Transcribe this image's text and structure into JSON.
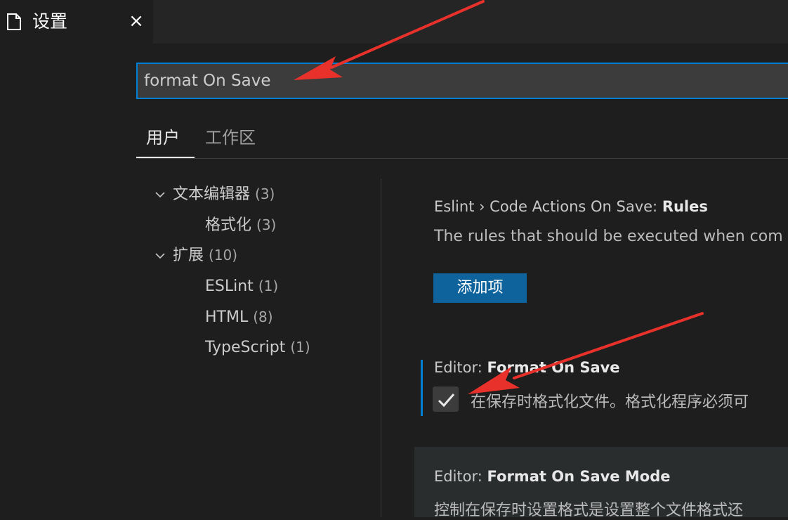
{
  "tab": {
    "title": "设置",
    "close": "×"
  },
  "search": {
    "value": "format On Save"
  },
  "scope_tabs": {
    "user": "用户",
    "workspace": "工作区"
  },
  "toc": {
    "items": [
      {
        "label": "文本编辑器",
        "count": "(3)"
      },
      {
        "label": "格式化",
        "count": "(3)"
      },
      {
        "label": "扩展",
        "count": "(10)"
      },
      {
        "label": "ESLint",
        "count": "(1)"
      },
      {
        "label": "HTML",
        "count": "(8)"
      },
      {
        "label": "TypeScript",
        "count": "(1)"
      }
    ]
  },
  "settings": {
    "eslint": {
      "category": "Eslint › Code Actions On Save: ",
      "name": "Rules",
      "desc": "The rules that should be executed when com",
      "add_button": "添加项"
    },
    "format_on_save": {
      "category": "Editor: ",
      "name": "Format On Save",
      "desc": "在保存时格式化文件。格式化程序必须可",
      "checked": true
    },
    "format_on_save_mode": {
      "category": "Editor: ",
      "name": "Format On Save Mode",
      "desc": "控制在保存时设置格式是设置整个文件格式还"
    }
  },
  "colors": {
    "background": "#1e1e1e",
    "focus_border": "#007fd4",
    "button_bg": "#0e639c",
    "annotation_arrow": "#e8312b"
  }
}
